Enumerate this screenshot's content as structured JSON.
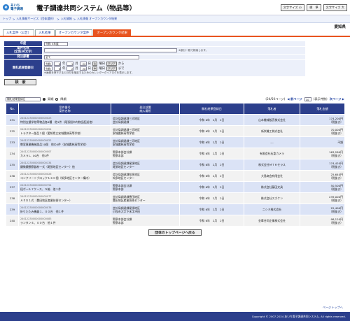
{
  "header": {
    "logo_mark": "e",
    "logo_line1": "あいち",
    "logo_line2": "電子調達",
    "system_title": "電子調達共同システム（物品等）",
    "buttons": [
      "文字サイズ 小",
      "標　準",
      "文字サイズ 大"
    ]
  },
  "breadcrumb": [
    "トップ",
    "入札情報サービス（団体選択）",
    "入札情報",
    "入札情報 オープンカウンタ結果"
  ],
  "region": "愛知県",
  "tabs": [
    "入札案件（公告）",
    "入札結果",
    "オープンカウンタ案件",
    "オープンカウンタ結果"
  ],
  "form": {
    "nendo": {
      "label": "年度",
      "value": "令和 5年度"
    },
    "anken": {
      "label": "案件名称\n（全角30文字）",
      "note": "※部分一致で検索します。"
    },
    "hacchu": {
      "label": "発注部署",
      "value": "全て"
    },
    "kettei": {
      "label": "開札結果登録日",
      "era1": "令和",
      "y1": "6",
      "m1": "1",
      "d1": "20",
      "dow1": "土",
      "era2": "令和",
      "y2": "6",
      "m2": "2",
      "d2": "28",
      "dow2": "木",
      "clear": "クリア",
      "from": "から",
      "to": "まで",
      "note": "※画像を押下すると日付を指定するためのカレンダーダイアログを表示します。"
    },
    "search_button": "検　索"
  },
  "controls": {
    "sort": "開札結果登録日",
    "asc": "昇順",
    "desc": "降順",
    "count_text": "(表示件数)",
    "per_page": "10",
    "page_text": "(24/50ページ)",
    "prev": "前ページ",
    "next": "次ページ",
    "total_text": "表示件数"
  },
  "columns": [
    "No.",
    "案件番号\n案件名称",
    "発注部署\n納入場所",
    "開札結果登録日",
    "落札者",
    "落札金額"
  ],
  "rows": [
    {
      "no": "231",
      "id": "24012230000000000023",
      "title": "特別支援学校等物品各6種　他1件（尾張旭市内物品配送他）",
      "dept": "会計局調達課三河地区",
      "place": "会計局調達課",
      "date": "令和 6年　2月　2日",
      "winner": "山本機械販売株式会社",
      "amount": "174,200円",
      "tax": "（税抜き）"
    },
    {
      "no": "232",
      "id": "24012230000000000024",
      "title": "トラクター部品１個（愛知県立安城農林高等学校）",
      "dept": "会計局調達課三河地区",
      "place": "安城農林高等学校",
      "date": "令和 6年　2月　2日",
      "winner": "新栄機工株式会社",
      "amount": "70,000円",
      "tax": "（税抜き）"
    },
    {
      "no": "233",
      "id": "24012230000000000022",
      "title": "教室事業機械部品10個　他の4件（安城農林高等学校）",
      "dept": "会計局調達課三河地区",
      "place": "安城農林高等学校",
      "date": "令和 6年　2月　2日",
      "winner": "---",
      "amount": "不調",
      "tax": ""
    },
    {
      "no": "234",
      "id": "24012230000000000007",
      "title": "カメラ1、00台　他1件",
      "dept": "警察本部会計課",
      "place": "警察本部",
      "date": "令和 6年　2月　2日",
      "winner": "有限会社石倉カメラ",
      "amount": "163,280円",
      "tax": "（税抜き）"
    },
    {
      "no": "235",
      "id": "24012230000000000134",
      "title": "顕微鏡観察器材一式（尾張地区センター）他",
      "dept": "会計局調達課尾張地区",
      "place": "尾張地区センター",
      "date": "令和 6年　2月　2日",
      "winner": "株式会社ＭＴＫセラス",
      "amount": "174,420円",
      "tax": "（税抜き）"
    },
    {
      "no": "236",
      "id": "24012230000000000026",
      "title": "コンクリートブロック１６０個（知多地区センター構内）",
      "dept": "会計局調達課知多地区",
      "place": "知多地区センター",
      "date": "令和 6年　2月　2日",
      "winner": "大島商会有限会社",
      "amount": "25,640円",
      "tax": "（税抜き）"
    },
    {
      "no": "237",
      "id": "24012230000000000754",
      "title": "段ボール７ケース、５箱　他１件",
      "dept": "警察本部会計課",
      "place": "警察本部",
      "date": "令和 6年　2月　2日",
      "winner": "株式会社藤田文具",
      "amount": "50,500円",
      "tax": "（税抜き）"
    },
    {
      "no": "238",
      "id": "24012230000000000077",
      "title": "ＡＥＤ１式（豊田地区産業技術センター）",
      "dept": "会計局調達課豊田地区",
      "place": "豊田地区産業技術センター",
      "date": "令和 6年　2月　2日",
      "winner": "株式会社スズケン",
      "amount": "239,000円",
      "tax": "（税抜き）"
    },
    {
      "no": "239",
      "id": "24012230000000000076",
      "title": "折りたたみ機器１、００台　他１件",
      "dept": "会計局調達課尾張地区",
      "place": "小牧市大字下末字沖田",
      "date": "令和 6年　2月　2日",
      "winner": "ニシキ株式会社",
      "amount": "22,400円",
      "tax": "（税抜き）"
    },
    {
      "no": "240",
      "id": "24012230000000000083",
      "title": "ランタン４、００台　他１件",
      "dept": "警察本部会計課",
      "place": "警察本部",
      "date": "令和 6年　2月　2日",
      "winner": "金華合同企業株式会社",
      "amount": "98,120円",
      "tax": "（税抜き）"
    }
  ],
  "back_button": "団体のトップページへ戻る",
  "page_top": "ページトップへ",
  "footer": "Copyright © 2007-2024 あいち電子調達共同システム. All rights reserved."
}
